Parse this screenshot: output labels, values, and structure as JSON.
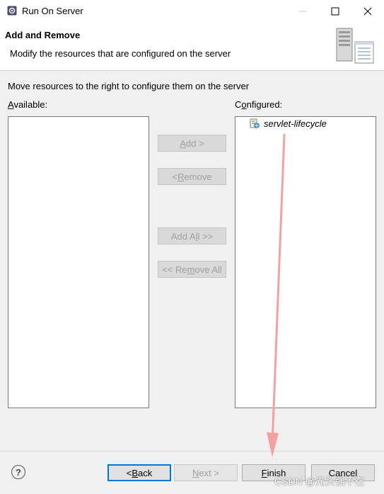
{
  "window": {
    "title": "Run On Server",
    "icons": {
      "app": "server-gear-icon",
      "minimize": "minimize-icon",
      "maximize": "maximize-icon",
      "close": "close-icon"
    }
  },
  "header": {
    "title": "Add and Remove",
    "description": "Modify the resources that are configured on the server",
    "image": "server-list-icon"
  },
  "body": {
    "instruction": "Move resources to the right to configure them on the server",
    "available": {
      "label_mnemonic": "A",
      "label_rest": "vailable:",
      "items": []
    },
    "configured": {
      "label_prefix": "C",
      "label_mnemonic": "o",
      "label_rest": "nfigured:",
      "items": [
        {
          "label": "servlet-lifecycle",
          "icon": "web-module-icon"
        }
      ]
    },
    "buttons": {
      "add": {
        "pre": "",
        "mn": "A",
        "post": "dd >"
      },
      "remove": {
        "pre": "< ",
        "mn": "R",
        "post": "emove"
      },
      "add_all": {
        "pre": "Add A",
        "mn": "l",
        "post": "l >>"
      },
      "remove_all": {
        "pre": "<< Re",
        "mn": "m",
        "post": "ove All"
      }
    }
  },
  "footer": {
    "help_icon": "help-icon",
    "back": {
      "pre": "< ",
      "mn": "B",
      "post": "ack"
    },
    "next": {
      "pre": "",
      "mn": "N",
      "post": "ext >"
    },
    "finish": {
      "pre": "",
      "mn": "F",
      "post": "inish"
    },
    "cancel": "Cancel"
  },
  "watermark": "CSDN @光头强不在",
  "annotation": {
    "color": "#f4a0a0"
  }
}
